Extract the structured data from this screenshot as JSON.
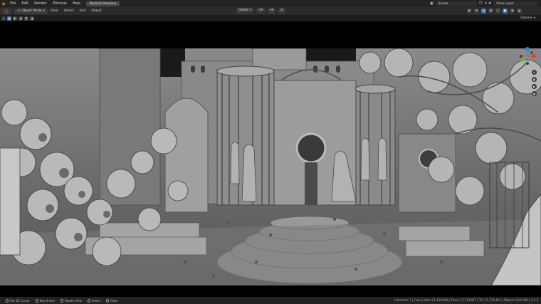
{
  "topbar": {
    "menus": [
      "File",
      "Edit",
      "Render",
      "Window",
      "Help"
    ],
    "back_button": "Back to Previous",
    "scene": "Scene",
    "view_layer": "View Layer"
  },
  "header": {
    "editor_icon": "3d-viewport-icon",
    "mode": "Object Mode",
    "menus": [
      "View",
      "Select",
      "Add",
      "Object"
    ],
    "orientation": "Global"
  },
  "toolbar": {
    "options": "Options"
  },
  "statusbar": {
    "items": [
      {
        "label": "Set 3D Cursor"
      },
      {
        "label": "Box Select"
      },
      {
        "label": "Rotate View"
      },
      {
        "label": "Select"
      },
      {
        "label": "Move"
      }
    ],
    "stats": "Collection 7 | Cube | Verts 21,130,866 | Faces 17,174,857 | Tris 21,774,412 | Objects 0/14,360 | 3.1.2"
  },
  "colors": {
    "accent": "#4772b3",
    "blender_orange": "#e87d0d",
    "axis_x": "#e63946",
    "axis_y": "#6bbf3b",
    "axis_z": "#3f7fe0"
  }
}
